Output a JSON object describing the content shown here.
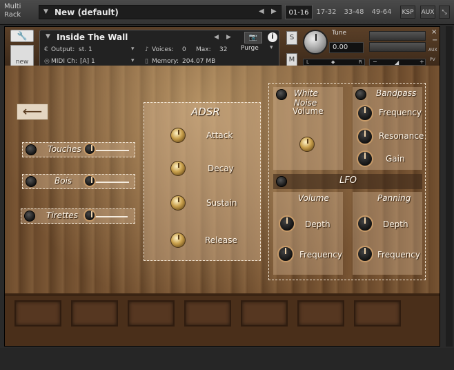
{
  "rack": {
    "title": "Multi Rack",
    "preset_name": "New (default)",
    "ranges": [
      "01-16",
      "17-32",
      "33-48",
      "49-64"
    ],
    "active_range": "01-16",
    "ksp": "KSP",
    "aux": "AUX"
  },
  "instrument": {
    "name": "Inside The Wall",
    "output_label": "Output:",
    "output_value": "st. 1",
    "voices_label": "Voices:",
    "voices_value": "0",
    "max_label": "Max:",
    "max_value": "32",
    "purge": "Purge",
    "midi_label": "MIDI Ch:",
    "midi_value": "[A]  1",
    "memory_label": "Memory:",
    "memory_value": "204.07 MB",
    "new_label": "new",
    "tune_label": "Tune",
    "tune_value": "0.00",
    "solo": "S",
    "mute": "M",
    "pan_left": "L",
    "pan_right": "R",
    "aux_label": "AUX",
    "pv_label": "PV"
  },
  "left_sliders": [
    {
      "label": "Touches"
    },
    {
      "label": "Bois"
    },
    {
      "label": "Tirettes"
    }
  ],
  "adsr": {
    "title": "ADSR",
    "knobs": [
      "Attack",
      "Decay",
      "Sustain",
      "Release"
    ]
  },
  "white_noise": {
    "title": "White Noise",
    "knob": "Volume"
  },
  "bandpass": {
    "title": "Bandpass",
    "knobs": [
      "Frequency",
      "Resonance",
      "Gain"
    ]
  },
  "lfo": {
    "title": "LFO",
    "volume": {
      "title": "Volume",
      "knobs": [
        "Depth",
        "Frequency"
      ]
    },
    "panning": {
      "title": "Panning",
      "knobs": [
        "Depth",
        "Frequency"
      ]
    }
  }
}
